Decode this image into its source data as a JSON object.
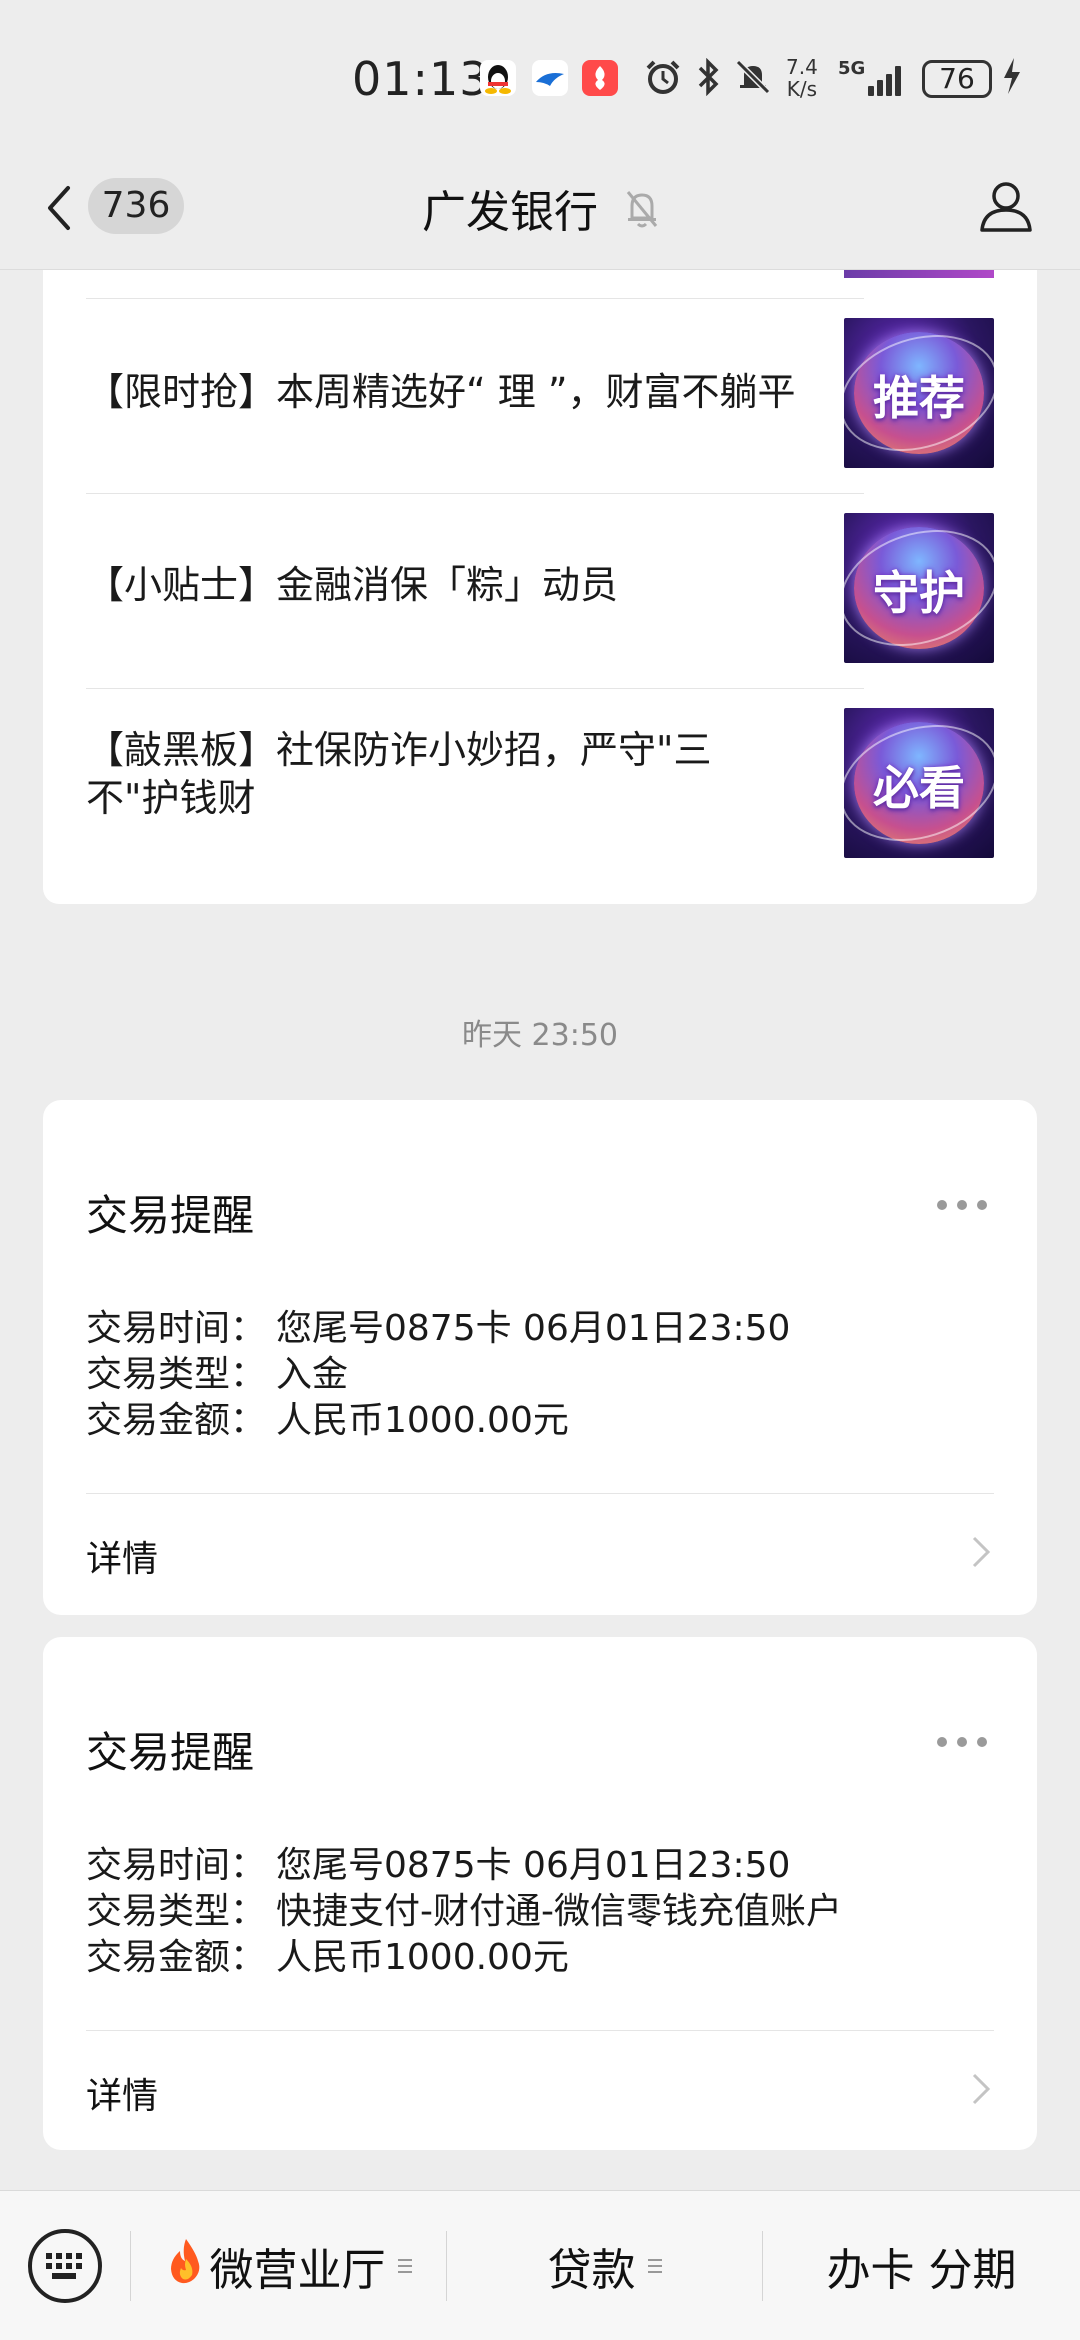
{
  "status_bar": {
    "time": "01:13",
    "net_speed_value": "7.4",
    "net_speed_unit": "K/s",
    "signal": "5G",
    "battery": "76"
  },
  "header": {
    "back_count": "736",
    "title": "广发银行"
  },
  "articles": [
    {
      "text": "【限时抢】本周精选好“ 理 ”，财富不躺平",
      "thumb_label": "推荐"
    },
    {
      "text": "【小贴士】金融消保「粽」动员",
      "thumb_label": "守护"
    },
    {
      "text": "【敲黑板】社保防诈小妙招，严守\"三不\"护钱财",
      "thumb_label": "必看"
    }
  ],
  "timestamp": "昨天 23:50",
  "transactions": [
    {
      "title": "交易提醒",
      "rows": [
        {
          "label": "交易时间：",
          "value": "您尾号0875卡 06月01日23:50"
        },
        {
          "label": "交易类型：",
          "value": "入金"
        },
        {
          "label": "交易金额：",
          "value": "人民币1000.00元"
        }
      ],
      "detail": "详情"
    },
    {
      "title": "交易提醒",
      "rows": [
        {
          "label": "交易时间：",
          "value": "您尾号0875卡 06月01日23:50"
        },
        {
          "label": "交易类型：",
          "value": "快捷支付-财付通-微信零钱充值账户"
        },
        {
          "label": "交易金额：",
          "value": "人民币1000.00元"
        }
      ],
      "detail": "详情"
    }
  ],
  "bottom_menu": {
    "items": [
      {
        "label": "微营业厅",
        "icon": "fire-icon"
      },
      {
        "label": "贷款"
      },
      {
        "label": "办卡 分期"
      }
    ]
  }
}
